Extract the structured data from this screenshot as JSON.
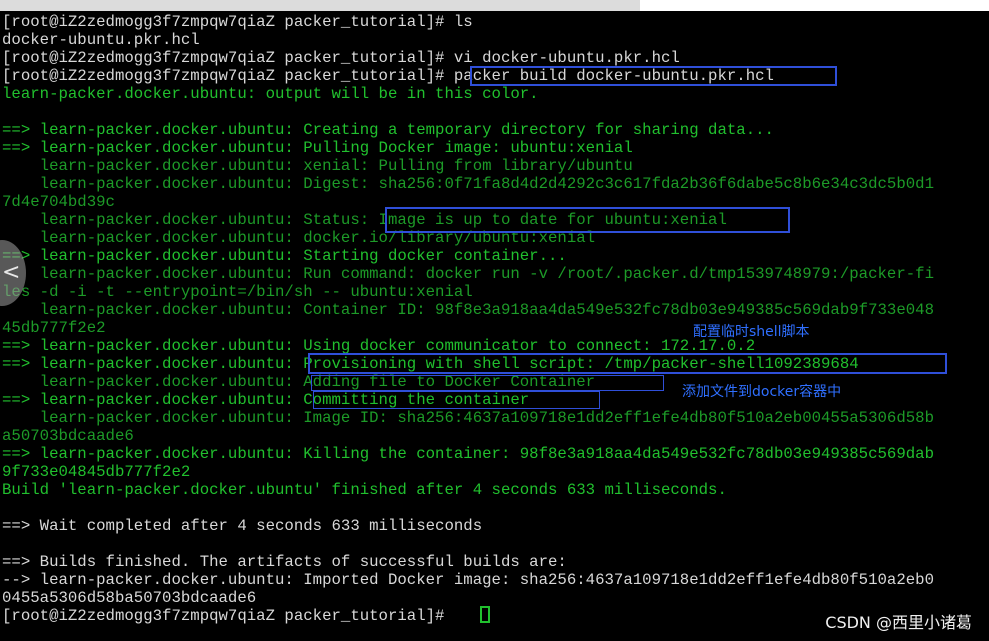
{
  "terminal": {
    "lines": [
      {
        "text": "[root@iZ2zedmogg3f7zmpqw7qiaZ packer_tutorial]# ls",
        "color": "w"
      },
      {
        "text": "docker-ubuntu.pkr.hcl",
        "color": "w"
      },
      {
        "text": "[root@iZ2zedmogg3f7zmpqw7qiaZ packer_tutorial]# vi docker-ubuntu.pkr.hcl",
        "color": "w"
      },
      {
        "text": "[root@iZ2zedmogg3f7zmpqw7qiaZ packer_tutorial]# packer build docker-ubuntu.pkr.hcl",
        "color": "w"
      },
      {
        "text": "learn-packer.docker.ubuntu: output will be in this color.",
        "color": "g"
      },
      {
        "text": "",
        "color": "g"
      },
      {
        "text": "==> learn-packer.docker.ubuntu: Creating a temporary directory for sharing data...",
        "color": "g"
      },
      {
        "text": "==> learn-packer.docker.ubuntu: Pulling Docker image: ubuntu:xenial",
        "color": "g"
      },
      {
        "text": "    learn-packer.docker.ubuntu: xenial: Pulling from library/ubuntu",
        "color": "dg"
      },
      {
        "text": "    learn-packer.docker.ubuntu: Digest: sha256:0f71fa8d4d2d4292c3c617fda2b36f6dabe5c8b6e34c3dc5b0d1",
        "color": "dg"
      },
      {
        "text": "7d4e704bd39c",
        "color": "dg"
      },
      {
        "text": "    learn-packer.docker.ubuntu: Status: Image is up to date for ubuntu:xenial",
        "color": "dg"
      },
      {
        "text": "    learn-packer.docker.ubuntu: docker.io/library/ubuntu:xenial",
        "color": "dg"
      },
      {
        "text": "==> learn-packer.docker.ubuntu: Starting docker container...",
        "color": "g"
      },
      {
        "text": "    learn-packer.docker.ubuntu: Run command: docker run -v /root/.packer.d/tmp1539748979:/packer-fi",
        "color": "dg"
      },
      {
        "text": "les -d -i -t --entrypoint=/bin/sh -- ubuntu:xenial",
        "color": "dg"
      },
      {
        "text": "    learn-packer.docker.ubuntu: Container ID: 98f8e3a918aa4da549e532fc78db03e949385c569dab9f733e048",
        "color": "dg"
      },
      {
        "text": "45db777f2e2",
        "color": "dg"
      },
      {
        "text": "==> learn-packer.docker.ubuntu: Using docker communicator to connect: 172.17.0.2",
        "color": "g"
      },
      {
        "text": "==> learn-packer.docker.ubuntu: Provisioning with shell script: /tmp/packer-shell1092389684",
        "color": "g"
      },
      {
        "text": "    learn-packer.docker.ubuntu: Adding file to Docker Container",
        "color": "dg"
      },
      {
        "text": "==> learn-packer.docker.ubuntu: Committing the container",
        "color": "g"
      },
      {
        "text": "    learn-packer.docker.ubuntu: Image ID: sha256:4637a109718e1dd2eff1efe4db80f510a2eb00455a5306d58b",
        "color": "dg"
      },
      {
        "text": "a50703bdcaade6",
        "color": "dg"
      },
      {
        "text": "==> learn-packer.docker.ubuntu: Killing the container: 98f8e3a918aa4da549e532fc78db03e949385c569dab",
        "color": "g"
      },
      {
        "text": "9f733e04845db777f2e2",
        "color": "g"
      },
      {
        "text": "Build 'learn-packer.docker.ubuntu' finished after 4 seconds 633 milliseconds.",
        "color": "g"
      },
      {
        "text": "",
        "color": "w"
      },
      {
        "text": "==> Wait completed after 4 seconds 633 milliseconds",
        "color": "w"
      },
      {
        "text": "",
        "color": "w"
      },
      {
        "text": "==> Builds finished. The artifacts of successful builds are:",
        "color": "w"
      },
      {
        "text": "--> learn-packer.docker.ubuntu: Imported Docker image: sha256:4637a109718e1dd2eff1efe4db80f510a2eb0",
        "color": "w"
      },
      {
        "text": "0455a5306d58ba50703bdcaade6",
        "color": "w"
      },
      {
        "text": "[root@iZ2zedmogg3f7zmpqw7qiaZ packer_tutorial]# ",
        "color": "w"
      }
    ]
  },
  "annotations": {
    "shell_script_note": "配置临时shell脚本",
    "add_file_note": "添加文件到docker容器中"
  },
  "overlay": {
    "back_icon": "chevron-left-icon",
    "back_glyph": "<"
  },
  "watermark": "CSDN @西里小诸葛",
  "colors": {
    "background": "#000000",
    "prompt_text": "#d8d8d8",
    "packer_green": "#21c02e",
    "packer_dim_green": "#1d9b28",
    "highlight_box": "#2f4fd9",
    "annotation_text": "#2f6fff"
  }
}
